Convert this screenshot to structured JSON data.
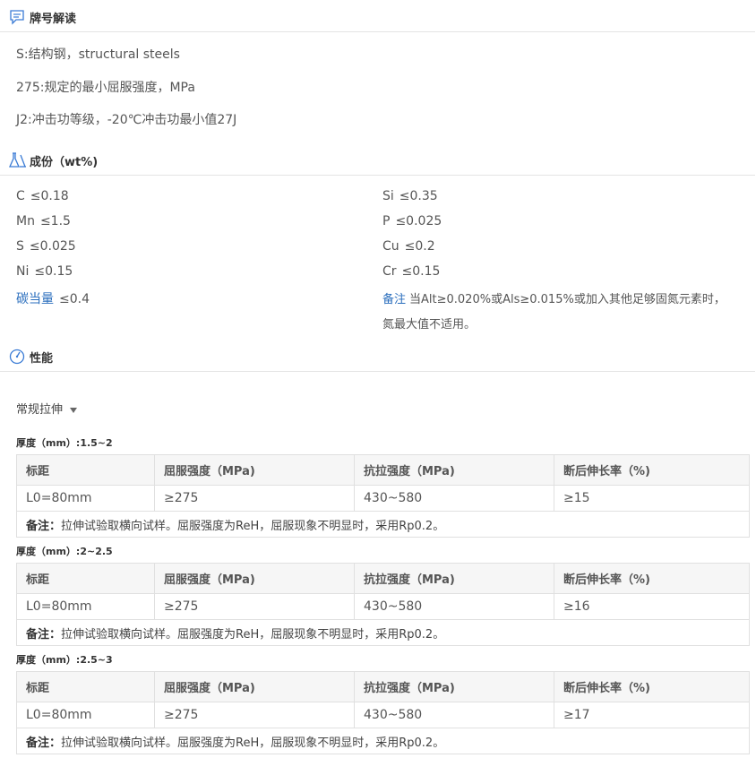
{
  "designation": {
    "title": "牌号解读",
    "lines": [
      "S:结构钢，structural steels",
      "275:规定的最小屈服强度，MPa",
      "J2:冲击功等级，-20℃冲击功最小值27J"
    ]
  },
  "composition": {
    "title": "成份（wt%)",
    "left": [
      {
        "el": "C",
        "val": "≤0.18"
      },
      {
        "el": "Mn",
        "val": "≤1.5"
      },
      {
        "el": "S",
        "val": "≤0.025"
      },
      {
        "el": "Ni",
        "val": "≤0.15"
      },
      {
        "el": "碳当量",
        "val": "≤0.4"
      }
    ],
    "right": [
      {
        "el": "Si",
        "val": "≤0.35"
      },
      {
        "el": "P",
        "val": "≤0.025"
      },
      {
        "el": "Cu",
        "val": "≤0.2"
      },
      {
        "el": "Cr",
        "val": "≤0.15"
      }
    ],
    "remark_label": "备注",
    "remark_line1": "当Alt≥0.020%或Als≥0.015%或加入其他足够固氮元素时，",
    "remark_line2": "氮最大值不适用。"
  },
  "performance": {
    "title": "性能",
    "dropdown": "常规拉伸",
    "headers": [
      "标距",
      "屈服强度（MPa)",
      "抗拉强度（MPa)",
      "断后伸长率（%)"
    ],
    "note_label": "备注：",
    "blocks": [
      {
        "thickness": "厚度（mm）:1.5~2",
        "row": [
          "L0=80mm",
          "≥275",
          "430~580",
          "≥15"
        ],
        "note": "拉伸试验取横向试样。屈服强度为ReH，屈服现象不明显时，采用Rp0.2。"
      },
      {
        "thickness": "厚度（mm）:2~2.5",
        "row": [
          "L0=80mm",
          "≥275",
          "430~580",
          "≥16"
        ],
        "note": "拉伸试验取横向试样。屈服强度为ReH，屈服现象不明显时，采用Rp0.2。"
      },
      {
        "thickness": "厚度（mm）:2.5~3",
        "row": [
          "L0=80mm",
          "≥275",
          "430~580",
          "≥17"
        ],
        "note": "拉伸试验取横向试样。屈服强度为ReH，屈服现象不明显时，采用Rp0.2。"
      }
    ]
  },
  "icons": {
    "designation": "comment-icon",
    "composition": "flask-icon",
    "performance": "gauge-icon"
  },
  "colors": {
    "icon": "#3a7bd5",
    "remark": "#2a6ebd"
  }
}
